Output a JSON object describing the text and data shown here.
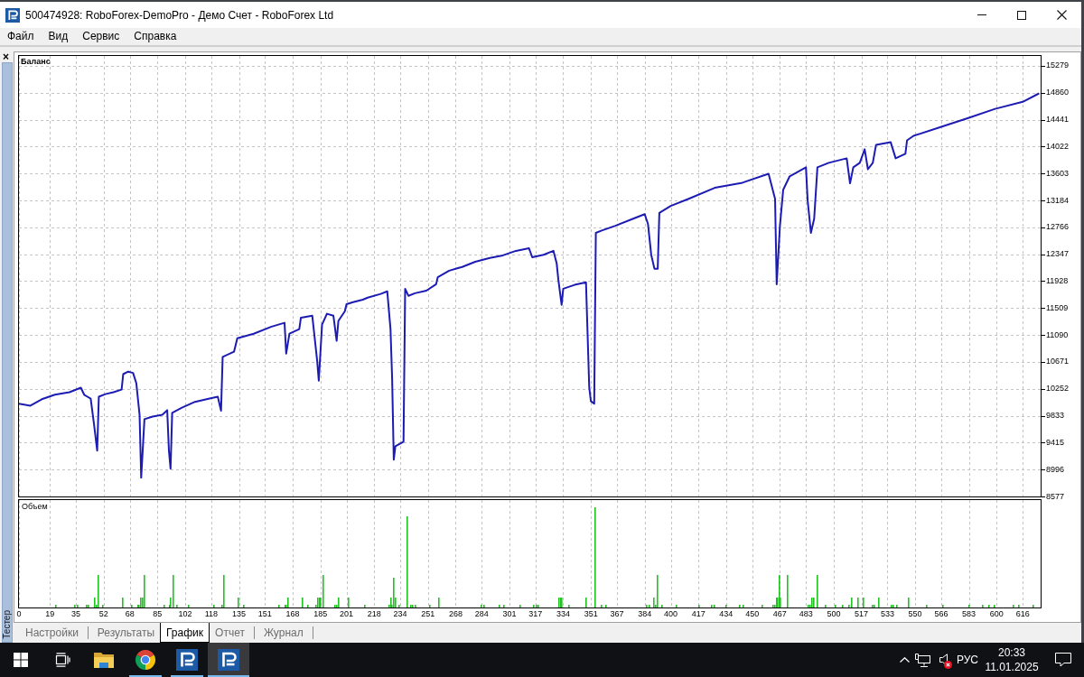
{
  "window": {
    "title": "500474928: RoboForex-DemoPro - Демо Счет - RoboForex Ltd"
  },
  "menu": [
    "Файл",
    "Вид",
    "Сервис",
    "Справка"
  ],
  "panel": {
    "close": "×",
    "title": "Тестер"
  },
  "chart": {
    "volume_label": "Объем",
    "chart_data": [
      {
        "type": "line",
        "title": "Баланс",
        "grid": true,
        "xlim": [
          0,
          627
        ],
        "y2lim": [
          8577,
          15433
        ],
        "xticks": [
          0,
          19,
          35,
          52,
          68,
          85,
          102,
          118,
          135,
          151,
          168,
          185,
          201,
          218,
          234,
          251,
          268,
          284,
          301,
          317,
          334,
          351,
          367,
          384,
          400,
          417,
          434,
          450,
          467,
          483,
          500,
          517,
          533,
          550,
          566,
          583,
          600,
          616
        ],
        "y2ticks": [
          15279,
          14860,
          14441,
          14022,
          13603,
          13184,
          12766,
          12347,
          11928,
          11509,
          11090,
          10671,
          10252,
          9833,
          9415,
          8996,
          8577
        ],
        "x": [
          0,
          7,
          14,
          22,
          31,
          38,
          40,
          42,
          44,
          46,
          48,
          49,
          53,
          58,
          63,
          64,
          67,
          70,
          72,
          74,
          75,
          77,
          82,
          88,
          91,
          92,
          93,
          94,
          100,
          108,
          117,
          122,
          124,
          125,
          132,
          134,
          144,
          155,
          163,
          164,
          166,
          172,
          173,
          180,
          183,
          184,
          186,
          189,
          193,
          195,
          196,
          200,
          201,
          205,
          211,
          214,
          222,
          226,
          228,
          229,
          230,
          231,
          236,
          237,
          239,
          243,
          250,
          256,
          257,
          264,
          272,
          280,
          289,
          297,
          305,
          313,
          315,
          322,
          328,
          330,
          331,
          333,
          334,
          341,
          348,
          350,
          351,
          353,
          354,
          358,
          366,
          377,
          384,
          386,
          388,
          390,
          392,
          393,
          400,
          411,
          427,
          444,
          460,
          464,
          465,
          467,
          469,
          473,
          483,
          484,
          486,
          488,
          490,
          497,
          508,
          510,
          512,
          516,
          519,
          521,
          524,
          526,
          535,
          538,
          544,
          545,
          549,
          566,
          583,
          599,
          616,
          626
        ],
        "series": [
          {
            "color": "#1c1cb4",
            "axis": "y2",
            "values": [
              10020,
              9990,
              10090,
              10160,
              10200,
              10270,
              10160,
              10130,
              10100,
              9710,
              9290,
              10130,
              10170,
              10200,
              10240,
              10480,
              10520,
              10500,
              10340,
              9850,
              8870,
              9780,
              9820,
              9850,
              9920,
              9290,
              9010,
              9880,
              9960,
              10050,
              10100,
              10130,
              9910,
              10750,
              10830,
              11040,
              11110,
              11220,
              11280,
              10800,
              11110,
              11180,
              11360,
              11390,
              10690,
              10380,
              11250,
              11420,
              11390,
              11000,
              11310,
              11460,
              11570,
              11600,
              11640,
              11670,
              11730,
              11770,
              11180,
              10410,
              9150,
              9360,
              9430,
              11810,
              11700,
              11740,
              11780,
              11880,
              11990,
              12090,
              12150,
              12230,
              12290,
              12330,
              12400,
              12440,
              12300,
              12340,
              12400,
              12200,
              11950,
              11560,
              11810,
              11870,
              11910,
              10270,
              10060,
              10020,
              12680,
              12720,
              12790,
              12900,
              12970,
              12820,
              12340,
              12120,
              12120,
              12990,
              13100,
              13210,
              13380,
              13460,
              13600,
              13210,
              11880,
              12790,
              13350,
              13560,
              13700,
              13180,
              12680,
              12900,
              13700,
              13770,
              13840,
              13450,
              13700,
              13770,
              13980,
              13670,
              13770,
              14050,
              14090,
              13840,
              13910,
              14120,
              14190,
              14330,
              14470,
              14610,
              14720,
              14850
            ]
          }
        ]
      }
    ]
  },
  "tabs": [
    {
      "label": "Настройки",
      "selected": false
    },
    {
      "label": "Результаты",
      "selected": false
    },
    {
      "label": "График",
      "selected": true
    },
    {
      "label": "Отчет",
      "selected": false
    },
    {
      "label": "Журнал",
      "selected": false
    }
  ],
  "taskbar": {
    "apps": [
      {
        "kind": "start",
        "running": false,
        "selected": false
      },
      {
        "kind": "taskview",
        "running": false,
        "selected": false
      },
      {
        "kind": "explorer",
        "running": false,
        "selected": false
      },
      {
        "kind": "browser",
        "running": true,
        "selected": false
      },
      {
        "kind": "app",
        "running": true,
        "selected": false
      },
      {
        "kind": "app",
        "running": true,
        "selected": true
      }
    ],
    "tray": {
      "language": "РУС",
      "time": "20:33",
      "date": "11.01.2025",
      "sound_muted": true
    }
  }
}
